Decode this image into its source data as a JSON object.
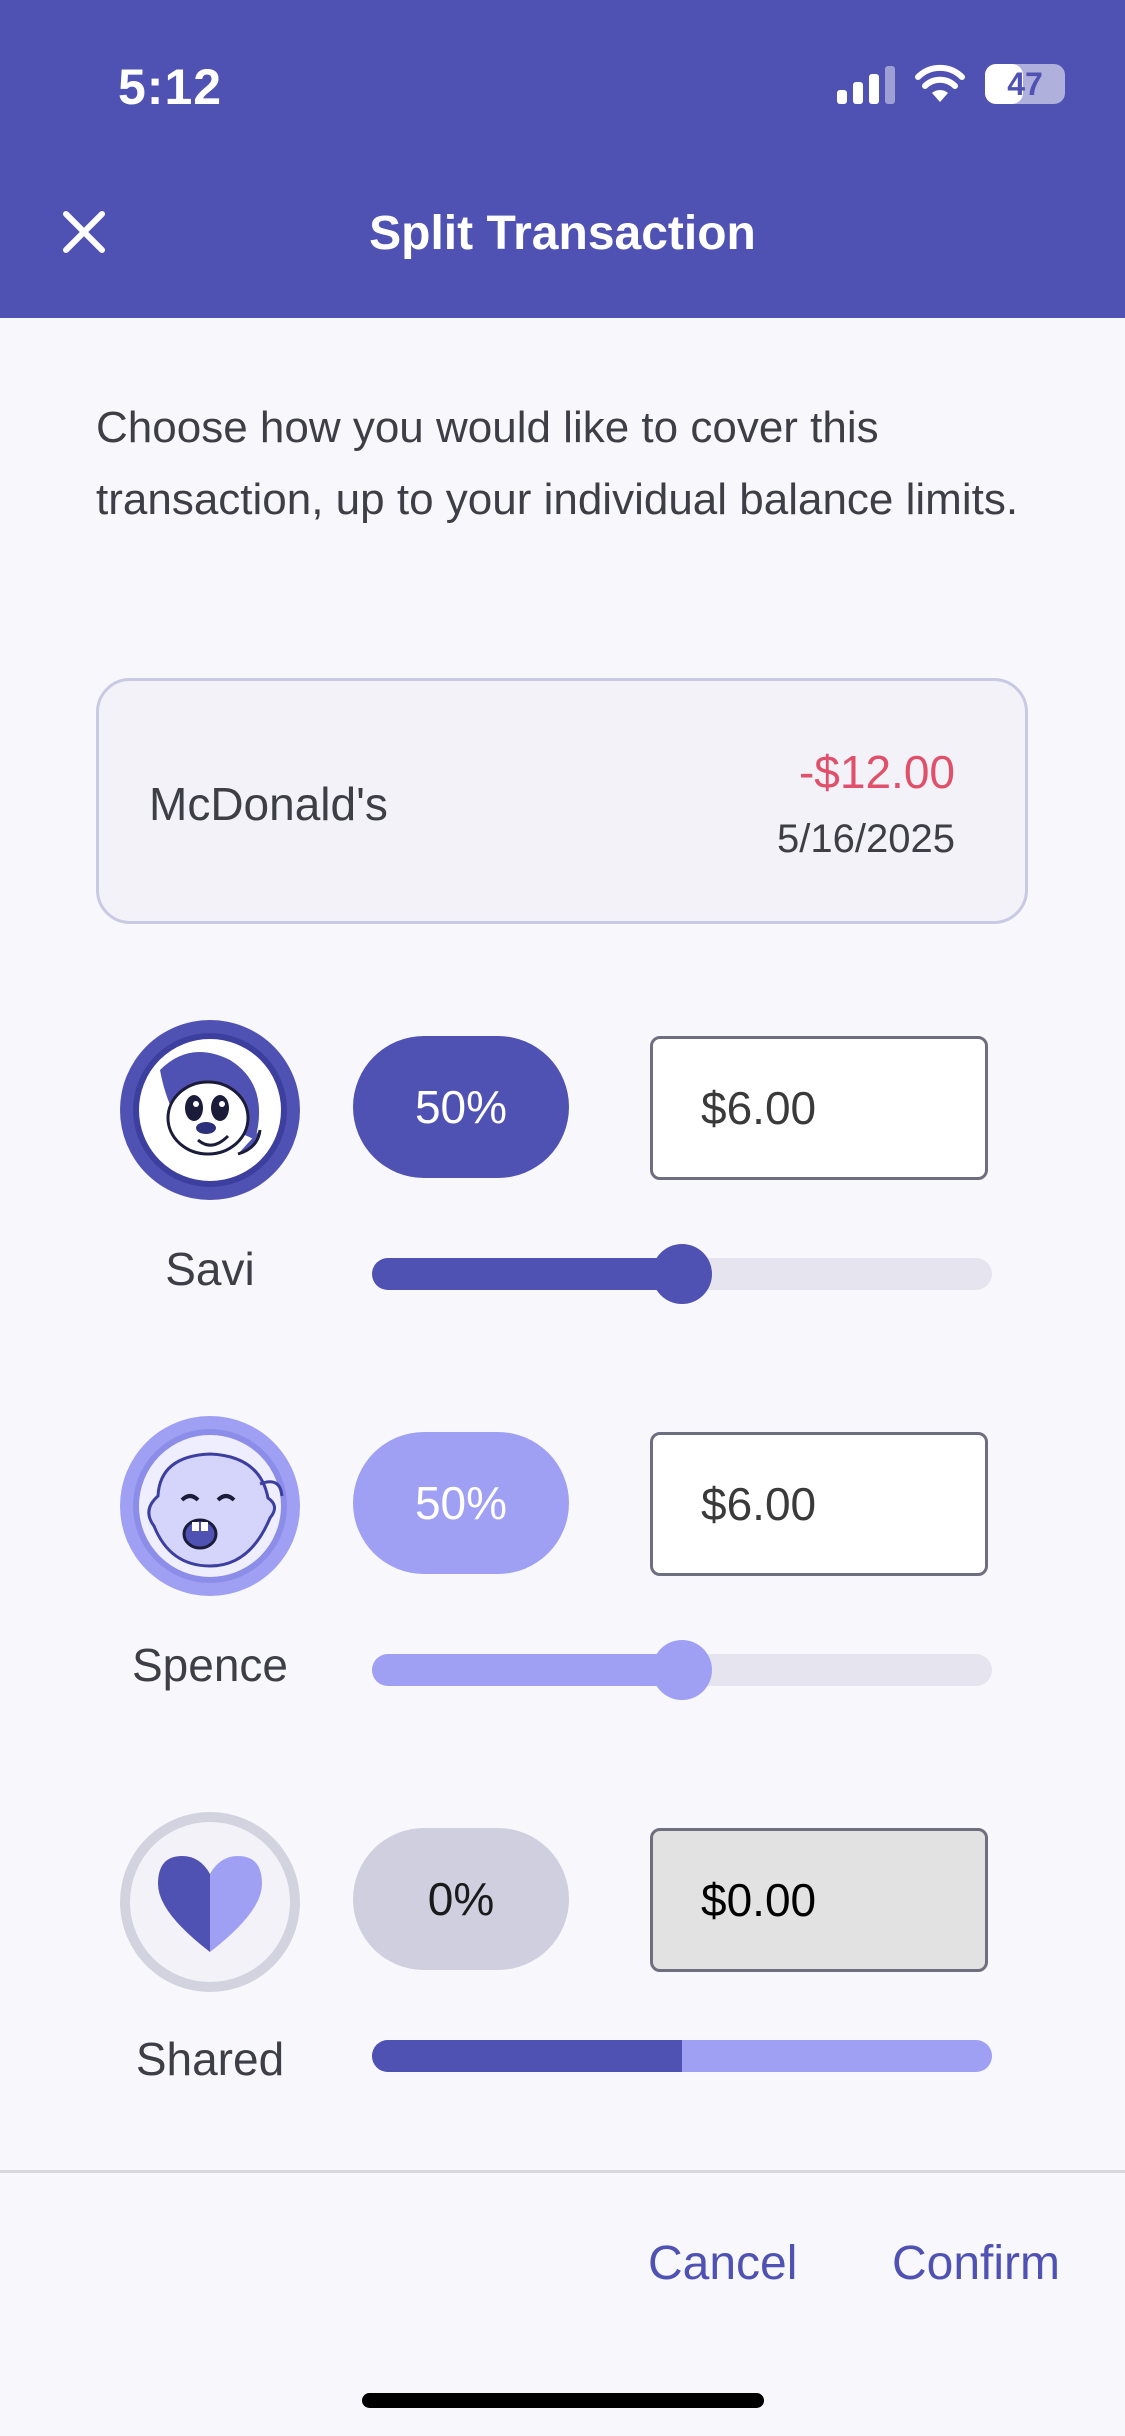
{
  "status_bar": {
    "time": "5:12",
    "battery": "47",
    "battery_level": 0.47
  },
  "header": {
    "title": "Split Transaction",
    "close_icon": "close-icon"
  },
  "intro_text": "Choose how you would like to cover this transaction, up to your individual balance limits.",
  "transaction": {
    "merchant": "McDonald's",
    "amount": "-$12.00",
    "date": "5/16/2025"
  },
  "members": [
    {
      "name": "Savi",
      "percent": "50%",
      "amount": "$6.00",
      "slider_value": 0.5,
      "color": "#4f52b2"
    },
    {
      "name": "Spence",
      "percent": "50%",
      "amount": "$6.00",
      "slider_value": 0.5,
      "color": "#9fa0f3"
    },
    {
      "name": "Shared",
      "percent": "0%",
      "amount": "$0.00",
      "slider_value": 0.5,
      "color": "#cfcfe0"
    }
  ],
  "footer": {
    "cancel_label": "Cancel",
    "confirm_label": "Confirm"
  },
  "colors": {
    "primary": "#4f52b2",
    "secondary": "#9fa0f3",
    "negative": "#e0506a"
  }
}
